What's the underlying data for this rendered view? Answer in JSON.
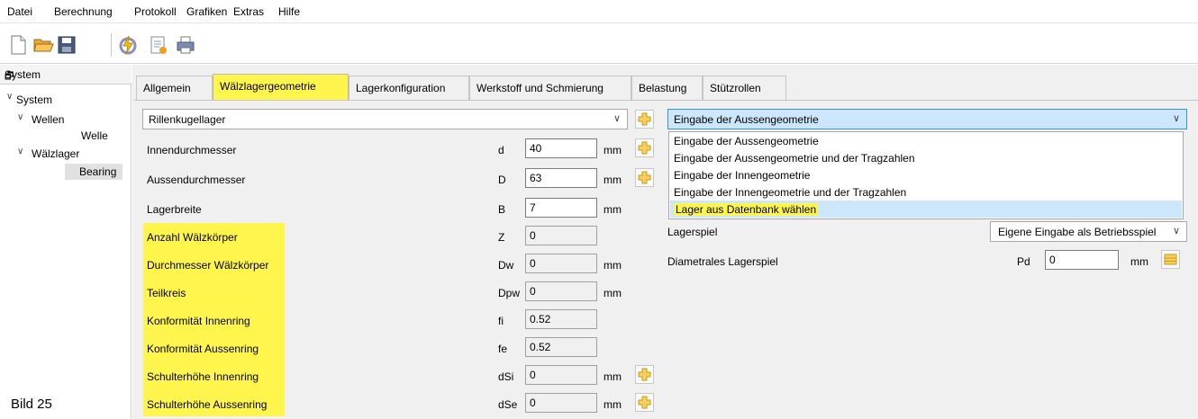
{
  "menu": [
    "Datei",
    "Berechnung",
    "Protokoll",
    "Grafiken",
    "Extras",
    "Hilfe"
  ],
  "toolbar": [
    "new-icon",
    "open-icon",
    "save-icon",
    "calculate-icon",
    "report-icon",
    "print-icon"
  ],
  "sidebar": {
    "title": "System",
    "tree": {
      "root": "System",
      "wellen": "Wellen",
      "welle": "Welle",
      "waelzlager": "Wälzlager",
      "bearing": "Bearing"
    }
  },
  "caption": "Bild 25",
  "tabs": [
    "Allgemein",
    "Wälzlagergeometrie",
    "Lagerkonfiguration",
    "Werkstoff und Schmierung",
    "Belastung",
    "Stützrollen"
  ],
  "bearing_type": "Rillenkugellager",
  "fields": [
    {
      "label": "Innendurchmesser",
      "symbol": "d",
      "value": "40",
      "unit": "mm"
    },
    {
      "label": "Aussendurchmesser",
      "symbol": "D",
      "value": "63",
      "unit": "mm"
    },
    {
      "label": "Lagerbreite",
      "symbol": "B",
      "value": "7",
      "unit": "mm"
    },
    {
      "label": "Anzahl Wälzkörper",
      "symbol": "Z",
      "value": "0",
      "unit": ""
    },
    {
      "label": "Durchmesser Wälzkörper",
      "symbol": "Dw",
      "value": "0",
      "unit": "mm"
    },
    {
      "label": "Teilkreis",
      "symbol": "Dpw",
      "value": "0",
      "unit": "mm"
    },
    {
      "label": "Konformität Innenring",
      "symbol": "fi",
      "value": "0.52",
      "unit": ""
    },
    {
      "label": "Konformität Aussenring",
      "symbol": "fe",
      "value": "0.52",
      "unit": ""
    },
    {
      "label": "Schulterhöhe Innenring",
      "symbol": "dSi",
      "value": "0",
      "unit": "mm"
    },
    {
      "label": "Schulterhöhe Aussenring",
      "symbol": "dSe",
      "value": "0",
      "unit": "mm"
    }
  ],
  "geometry_mode": {
    "selected": "Eingabe der Aussengeometrie",
    "options": [
      "Eingabe der Aussengeometrie",
      "Eingabe der Aussengeometrie und der Tragzahlen",
      "Eingabe der Innengeometrie",
      "Eingabe der Innengeometrie und der Tragzahlen",
      "Lager aus Datenbank wählen"
    ]
  },
  "lagerspiel": {
    "label": "Lagerspiel",
    "value": "Eigene Eingabe als Betriebsspiel"
  },
  "diametral": {
    "label": "Diametrales Lagerspiel",
    "symbol": "Pd",
    "value": "0",
    "unit": "mm"
  },
  "colors": {
    "highlight": "#fff54d",
    "selection": "#cce6fb",
    "accent": "#3a8fd6"
  }
}
